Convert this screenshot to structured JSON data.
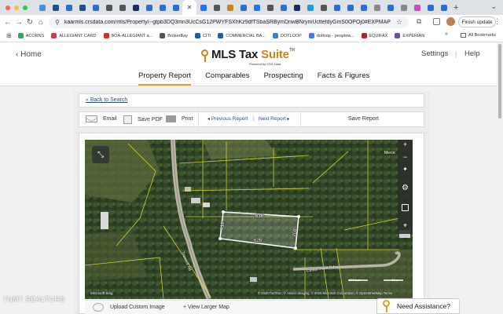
{
  "browser": {
    "url": "kaarmls.crsdata.com/mls/Property/--gtpb3DQ3mn3UcCsG12PWYFSXhKz9dfTSbaSRBymDnwBNrymUcttefdyGmS0OPOj0#EXPMAP",
    "finish_update_label": "Finish update",
    "bookmarks": [
      {
        "label": "ACORNS",
        "color": "#3aa655"
      },
      {
        "label": "ALLEGIANT CARD",
        "color": "#d23c3c"
      },
      {
        "label": "BOA-ALLEGIANT a...",
        "color": "#c0392b"
      },
      {
        "label": "BrokerBay",
        "color": "#555555"
      },
      {
        "label": "CITI",
        "color": "#1c5fa8"
      },
      {
        "label": "COMMERCIAL BA...",
        "color": "#1c5fa8"
      },
      {
        "label": "DOTLOOP",
        "color": "#3b7ddd"
      },
      {
        "label": "dotloop - peoplew...",
        "color": "#3b7ddd"
      },
      {
        "label": "EQUIFAX",
        "color": "#b3262f"
      },
      {
        "label": "EXPERIAN",
        "color": "#6b4fa2"
      }
    ],
    "all_bookmarks_label": "All Bookmarks"
  },
  "header": {
    "home_label": "Home",
    "logo_text": "MLS Tax ",
    "logo_accent": "Suite",
    "logo_tm": "TM",
    "powered_by": "Powered by CRS Data",
    "settings_label": "Settings",
    "help_label": "Help",
    "nav": [
      "Property Report",
      "Comparables",
      "Prospecting",
      "Facts & Figures"
    ]
  },
  "report": {
    "back_label": "« Back to Search",
    "email_label": "Email",
    "save_pdf_label": "Save PDF",
    "print_label": "Print",
    "prev_label": "Previous Report",
    "next_label": "Next Report",
    "save_report_label": "Save Report"
  },
  "map": {
    "label_top_right": "Merce",
    "road_label": "Center Point Rd",
    "road_label_2": "Tranquil Rd",
    "dim_top": "636'",
    "dim_bottom": "626'",
    "dim_left": "212'",
    "dim_right": "208'",
    "copyright": "© 2025 TomTom, © Vexcel Imaging, © 2025 Microsoft Corporation, © OpenStreetMap  Terms",
    "scale_ft": "200 feet",
    "scale_m": "50 m",
    "provider": "Microsoft Bing",
    "upload_label": "Upload Custom Image",
    "larger_map_label": "+ View Larger Map"
  },
  "watermark": "TNMT REALTORS",
  "assistance_label": "Need Assistance?"
}
